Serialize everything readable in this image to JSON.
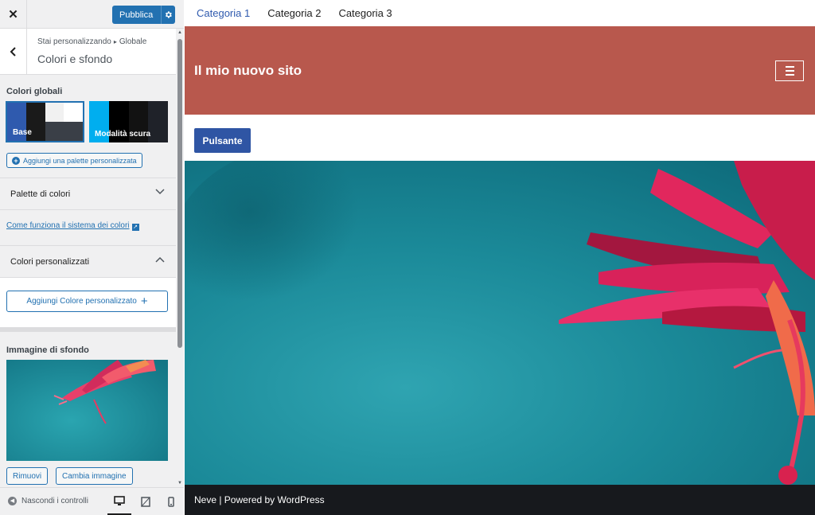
{
  "header": {
    "close_label": "✕",
    "publish_label": "Pubblica",
    "publish_icon": "gear-icon"
  },
  "titlebar": {
    "breadcrumb_prefix": "Stai personalizzando",
    "breadcrumb_section": "Globale",
    "section_title": "Colori e sfondo"
  },
  "global_colors": {
    "heading": "Colori globali",
    "palettes": [
      {
        "name": "Base",
        "selected": true,
        "colors": [
          "#2f5aae",
          "#1a1a1a",
          "#f7f7f7",
          "#ffffff"
        ],
        "bottom_colors": [
          "#2f5aae",
          "#1a1a1a",
          "#3a3f47",
          "#3a3f47"
        ]
      },
      {
        "name": "Modalità scura",
        "selected": false,
        "colors": [
          "#00aeef",
          "#000000",
          "#121212",
          "#1f2229"
        ],
        "bottom_colors": [
          "#00aeef",
          "#000000",
          "#121212",
          "#1f2229"
        ]
      }
    ],
    "add_palette_label": "Aggiungi una palette personalizzata"
  },
  "color_palette_section": {
    "title": "Palette di colori"
  },
  "help_link": {
    "label": "Come funziona il sistema dei colori"
  },
  "custom_colors": {
    "title": "Colori personalizzati",
    "add_label": "Aggiungi Colore personalizzato"
  },
  "background_image": {
    "heading": "Immagine di sfondo",
    "remove_label": "Rimuovi",
    "change_label": "Cambia immagine"
  },
  "footer_controls": {
    "hide_label": "Nascondi i controlli",
    "devices": [
      "desktop-icon",
      "tablet-icon",
      "mobile-icon"
    ],
    "active_device": "desktop"
  },
  "preview": {
    "nav": [
      "Categoria 1",
      "Categoria 2",
      "Categoria 3"
    ],
    "site_title": "Il mio nuovo sito",
    "button_label": "Pulsante",
    "footer_text": "Neve | Powered by WordPress",
    "colors": {
      "header_bg": "#b8584d",
      "button_bg": "#2f55a4",
      "footer_bg": "#17191d",
      "accent": "#2271b1"
    }
  }
}
